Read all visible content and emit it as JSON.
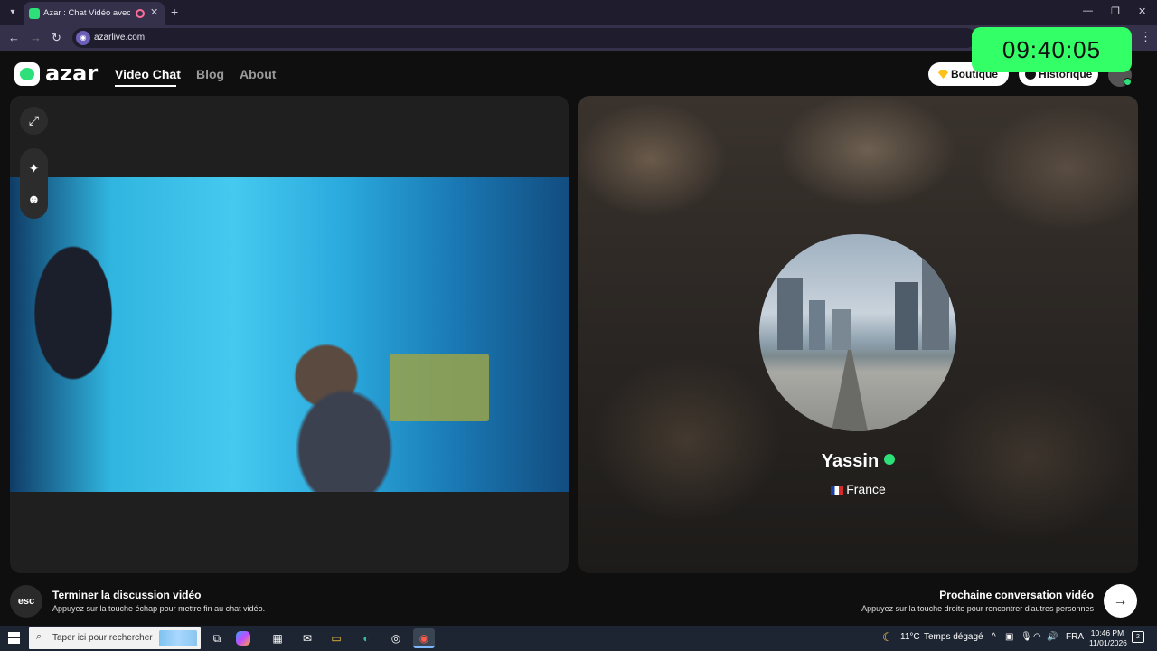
{
  "browser": {
    "tab_title": "Azar : Chat Vidéo avec de n",
    "url": "azarlive.com"
  },
  "overlay_clock": "09:40:05",
  "header": {
    "logo_text": "azar",
    "nav": [
      "Video Chat",
      "Blog",
      "About"
    ],
    "boutique_label": "Boutique",
    "historique_label": "Historique"
  },
  "partner": {
    "name": "Yassin",
    "country": "France"
  },
  "footer": {
    "esc_key": "esc",
    "end_title": "Terminer la discussion vidéo",
    "end_hint": "Appuyez sur la touche échap pour mettre fin au chat vidéo.",
    "next_title": "Prochaine conversation vidéo",
    "next_hint": "Appuyez sur la touche droite pour rencontrer d'autres personnes"
  },
  "taskbar": {
    "search_placeholder": "Taper ici pour rechercher",
    "weather_temp": "11°C",
    "weather_desc": "Temps dégagé",
    "language": "FRA",
    "time": "10:46 PM",
    "date": "11/01/2026",
    "notification_count": "2"
  },
  "icons": {
    "expand": "expand-icon",
    "sparkle": "sparkle-icon",
    "sticker": "sticker-icon",
    "next": "arrow-right-icon"
  },
  "colors": {
    "brand_green": "#2ee079",
    "clock_green": "#33ff66"
  }
}
